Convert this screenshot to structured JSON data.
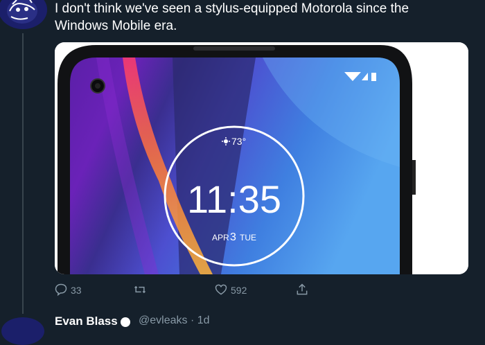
{
  "tweet": {
    "text_line1": "I don't think we've seen a stylus-equipped Motorola since the",
    "text_line2": "Windows Mobile era."
  },
  "media": {
    "weather": "73°",
    "time": "11:35",
    "date_month": "APR",
    "date_day": "3",
    "date_weekday": "TUE"
  },
  "actions": {
    "reply_count": "33",
    "retweet_count": "",
    "like_count": "592"
  },
  "next_tweet": {
    "name": "Evan Blass",
    "handle_time": "@evleaks · 1d"
  },
  "colors": {
    "background": "#15202b",
    "secondary_text": "#8899a6",
    "divider": "#38444d"
  }
}
